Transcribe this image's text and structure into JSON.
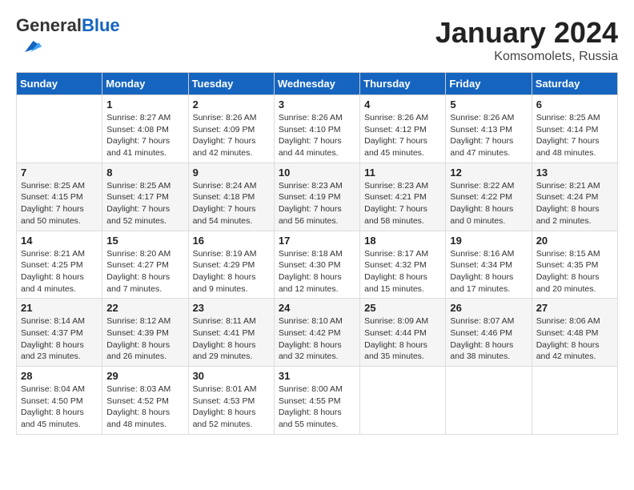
{
  "logo": {
    "general": "General",
    "blue": "Blue"
  },
  "header": {
    "month": "January 2024",
    "location": "Komsomolets, Russia"
  },
  "weekdays": [
    "Sunday",
    "Monday",
    "Tuesday",
    "Wednesday",
    "Thursday",
    "Friday",
    "Saturday"
  ],
  "weeks": [
    [
      {
        "day": "",
        "info": ""
      },
      {
        "day": "1",
        "info": "Sunrise: 8:27 AM\nSunset: 4:08 PM\nDaylight: 7 hours\nand 41 minutes."
      },
      {
        "day": "2",
        "info": "Sunrise: 8:26 AM\nSunset: 4:09 PM\nDaylight: 7 hours\nand 42 minutes."
      },
      {
        "day": "3",
        "info": "Sunrise: 8:26 AM\nSunset: 4:10 PM\nDaylight: 7 hours\nand 44 minutes."
      },
      {
        "day": "4",
        "info": "Sunrise: 8:26 AM\nSunset: 4:12 PM\nDaylight: 7 hours\nand 45 minutes."
      },
      {
        "day": "5",
        "info": "Sunrise: 8:26 AM\nSunset: 4:13 PM\nDaylight: 7 hours\nand 47 minutes."
      },
      {
        "day": "6",
        "info": "Sunrise: 8:25 AM\nSunset: 4:14 PM\nDaylight: 7 hours\nand 48 minutes."
      }
    ],
    [
      {
        "day": "7",
        "info": "Sunrise: 8:25 AM\nSunset: 4:15 PM\nDaylight: 7 hours\nand 50 minutes."
      },
      {
        "day": "8",
        "info": "Sunrise: 8:25 AM\nSunset: 4:17 PM\nDaylight: 7 hours\nand 52 minutes."
      },
      {
        "day": "9",
        "info": "Sunrise: 8:24 AM\nSunset: 4:18 PM\nDaylight: 7 hours\nand 54 minutes."
      },
      {
        "day": "10",
        "info": "Sunrise: 8:23 AM\nSunset: 4:19 PM\nDaylight: 7 hours\nand 56 minutes."
      },
      {
        "day": "11",
        "info": "Sunrise: 8:23 AM\nSunset: 4:21 PM\nDaylight: 7 hours\nand 58 minutes."
      },
      {
        "day": "12",
        "info": "Sunrise: 8:22 AM\nSunset: 4:22 PM\nDaylight: 8 hours\nand 0 minutes."
      },
      {
        "day": "13",
        "info": "Sunrise: 8:21 AM\nSunset: 4:24 PM\nDaylight: 8 hours\nand 2 minutes."
      }
    ],
    [
      {
        "day": "14",
        "info": "Sunrise: 8:21 AM\nSunset: 4:25 PM\nDaylight: 8 hours\nand 4 minutes."
      },
      {
        "day": "15",
        "info": "Sunrise: 8:20 AM\nSunset: 4:27 PM\nDaylight: 8 hours\nand 7 minutes."
      },
      {
        "day": "16",
        "info": "Sunrise: 8:19 AM\nSunset: 4:29 PM\nDaylight: 8 hours\nand 9 minutes."
      },
      {
        "day": "17",
        "info": "Sunrise: 8:18 AM\nSunset: 4:30 PM\nDaylight: 8 hours\nand 12 minutes."
      },
      {
        "day": "18",
        "info": "Sunrise: 8:17 AM\nSunset: 4:32 PM\nDaylight: 8 hours\nand 15 minutes."
      },
      {
        "day": "19",
        "info": "Sunrise: 8:16 AM\nSunset: 4:34 PM\nDaylight: 8 hours\nand 17 minutes."
      },
      {
        "day": "20",
        "info": "Sunrise: 8:15 AM\nSunset: 4:35 PM\nDaylight: 8 hours\nand 20 minutes."
      }
    ],
    [
      {
        "day": "21",
        "info": "Sunrise: 8:14 AM\nSunset: 4:37 PM\nDaylight: 8 hours\nand 23 minutes."
      },
      {
        "day": "22",
        "info": "Sunrise: 8:12 AM\nSunset: 4:39 PM\nDaylight: 8 hours\nand 26 minutes."
      },
      {
        "day": "23",
        "info": "Sunrise: 8:11 AM\nSunset: 4:41 PM\nDaylight: 8 hours\nand 29 minutes."
      },
      {
        "day": "24",
        "info": "Sunrise: 8:10 AM\nSunset: 4:42 PM\nDaylight: 8 hours\nand 32 minutes."
      },
      {
        "day": "25",
        "info": "Sunrise: 8:09 AM\nSunset: 4:44 PM\nDaylight: 8 hours\nand 35 minutes."
      },
      {
        "day": "26",
        "info": "Sunrise: 8:07 AM\nSunset: 4:46 PM\nDaylight: 8 hours\nand 38 minutes."
      },
      {
        "day": "27",
        "info": "Sunrise: 8:06 AM\nSunset: 4:48 PM\nDaylight: 8 hours\nand 42 minutes."
      }
    ],
    [
      {
        "day": "28",
        "info": "Sunrise: 8:04 AM\nSunset: 4:50 PM\nDaylight: 8 hours\nand 45 minutes."
      },
      {
        "day": "29",
        "info": "Sunrise: 8:03 AM\nSunset: 4:52 PM\nDaylight: 8 hours\nand 48 minutes."
      },
      {
        "day": "30",
        "info": "Sunrise: 8:01 AM\nSunset: 4:53 PM\nDaylight: 8 hours\nand 52 minutes."
      },
      {
        "day": "31",
        "info": "Sunrise: 8:00 AM\nSunset: 4:55 PM\nDaylight: 8 hours\nand 55 minutes."
      },
      {
        "day": "",
        "info": ""
      },
      {
        "day": "",
        "info": ""
      },
      {
        "day": "",
        "info": ""
      }
    ]
  ]
}
